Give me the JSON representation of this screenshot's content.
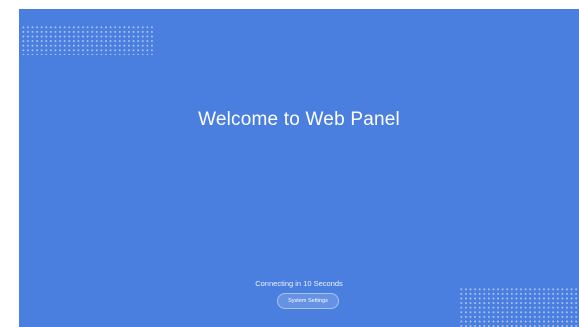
{
  "main": {
    "title": "Welcome to Web Panel",
    "status": "Connecting in 10 Seconds",
    "settings_button_label": "System Settings"
  },
  "colors": {
    "background": "#4a7fdf",
    "text": "#ffffff"
  }
}
